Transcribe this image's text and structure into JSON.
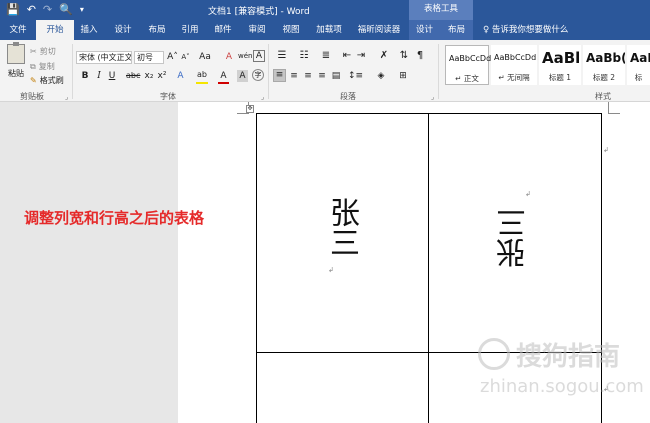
{
  "titlebar": {
    "title": "文档1 [兼容模式] - Word",
    "context_group": "表格工具",
    "qat": {
      "save": "save-icon",
      "undo": "undo-icon",
      "redo": "redo-icon",
      "preview": "print-preview-icon",
      "more": "customize-qat-icon"
    }
  },
  "tabs": [
    "文件",
    "开始",
    "插入",
    "设计",
    "布局",
    "引用",
    "邮件",
    "审阅",
    "视图",
    "加载项",
    "福昕阅读器",
    "设计",
    "布局"
  ],
  "active_tab": "开始",
  "tell_me": "♀ 告诉我你想要做什么",
  "ribbon": {
    "clipboard": {
      "label": "剪贴板",
      "paste": "粘贴",
      "cut": "剪切",
      "copy": "复制",
      "format_painter": "格式刷"
    },
    "font": {
      "label": "字体",
      "font_name": "宋体 (中文正文)",
      "font_size": "初号",
      "grow": "A˄",
      "shrink": "A˅",
      "case": "Aa",
      "clear": "A",
      "phonetic": "wén",
      "border_char": "A",
      "bold": "B",
      "italic": "I",
      "underline": "U",
      "strike": "abc",
      "subscript": "x₂",
      "superscript": "x²",
      "text_effect": "A",
      "highlight": "ab",
      "font_color": "A",
      "char_shade": "A",
      "enclose": "字",
      "highlight_color": "#f5e500",
      "font_color_value": "#d00000"
    },
    "paragraph": {
      "label": "段落"
    },
    "styles": {
      "label": "样式",
      "items": [
        {
          "preview": "AaBbCcDd",
          "name": "↵ 正文"
        },
        {
          "preview": "AaBbCcDd",
          "name": "↵ 无间隔"
        },
        {
          "preview": "AaBl",
          "name": "标题 1"
        },
        {
          "preview": "AaBb(",
          "name": "标题 2"
        },
        {
          "preview": "AaI",
          "name": "标"
        }
      ]
    }
  },
  "document": {
    "annotation": "调整列宽和行高之后的表格",
    "cell_left": "张三",
    "cell_right": "张三",
    "watermark": "搜狗指南",
    "watermark_url": "zhinan.sogou.com"
  }
}
